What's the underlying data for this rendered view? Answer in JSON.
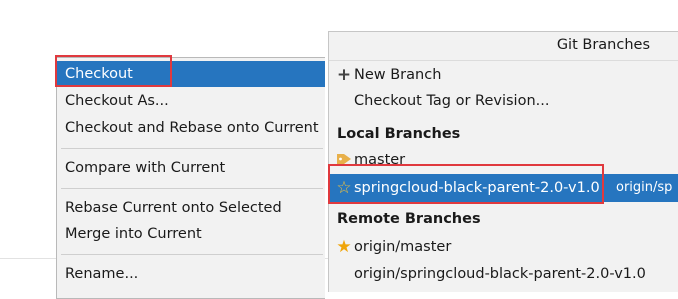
{
  "context_menu": {
    "items": [
      {
        "label": "Checkout"
      },
      {
        "label": "Checkout As..."
      },
      {
        "label": "Checkout and Rebase onto Current"
      },
      {
        "label": "Compare with Current"
      },
      {
        "label": "Rebase Current onto Selected"
      },
      {
        "label": "Merge into Current"
      },
      {
        "label": "Rename..."
      }
    ],
    "selected": "Checkout"
  },
  "git_branches": {
    "title": "Git Branches",
    "actions": [
      {
        "label": "New Branch",
        "icon": "plus-icon"
      },
      {
        "label": "Checkout Tag or Revision..."
      }
    ],
    "local_header": "Local Branches",
    "local": [
      {
        "name": "master",
        "icon": "tag-icon"
      },
      {
        "name": "springcloud-black-parent-2.0-v1.0",
        "icon": "star-outline-icon",
        "tracking": "origin/sp"
      }
    ],
    "remote_header": "Remote Branches",
    "remote": [
      {
        "name": "origin/master",
        "icon": "star-filled-icon"
      },
      {
        "name": "origin/springcloud-black-parent-2.0-v1.0"
      }
    ]
  },
  "colors": {
    "selection": "#2675bf",
    "highlight_box": "#e0393e",
    "star": "#f0a50a",
    "tag": "#e8b04a"
  }
}
